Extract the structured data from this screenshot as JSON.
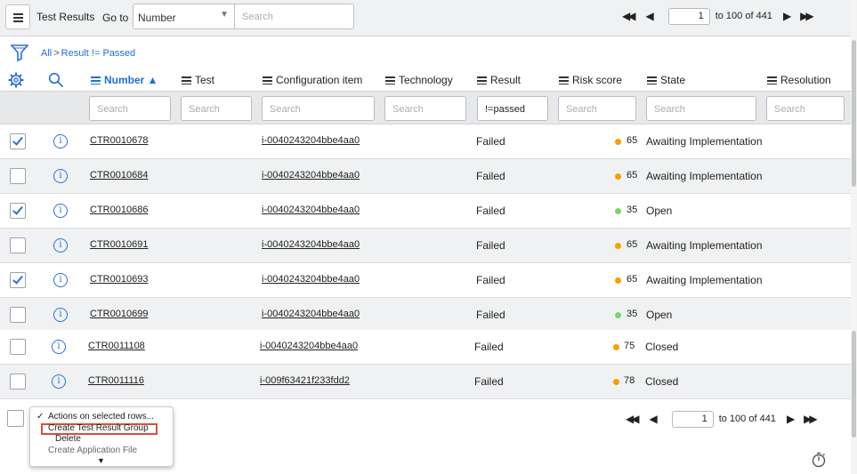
{
  "header": {
    "title": "Test Results",
    "goto_label": "Go to",
    "goto_select": "Number",
    "goto_search_placeholder": "Search",
    "pager": {
      "first": "◀◀",
      "prev": "◀",
      "next": "▶",
      "last": "▶▶",
      "page_value": "1",
      "range_text": "to 100 of 441"
    }
  },
  "breadcrumb": {
    "all": "All",
    "separator": ">",
    "filter": "Result != Passed"
  },
  "columns": {
    "number": "Number ▲",
    "test": "Test",
    "configuration_item": "Configuration item",
    "technology": "Technology",
    "result": "Result",
    "risk_score": "Risk score",
    "state": "State",
    "resolution": "Resolution"
  },
  "filters": {
    "number": "Search",
    "test": "Search",
    "configuration_item": "Search",
    "technology": "Search",
    "result": "!=passed",
    "risk_score": "Search",
    "state": "Search",
    "resolution": "Search"
  },
  "rows": [
    {
      "checked": true,
      "number": "CTR0010678",
      "ci": "i-0040243204bbe4aa0",
      "result": "Failed",
      "score": "65",
      "score_color": "#f4a100",
      "state": "Awaiting Implementation"
    },
    {
      "checked": false,
      "number": "CTR0010684",
      "ci": "i-0040243204bbe4aa0",
      "result": "Failed",
      "score": "65",
      "score_color": "#f4a100",
      "state": "Awaiting Implementation"
    },
    {
      "checked": true,
      "number": "CTR0010686",
      "ci": "i-0040243204bbe4aa0",
      "result": "Failed",
      "score": "35",
      "score_color": "#7ed46a",
      "state": "Open"
    },
    {
      "checked": false,
      "number": "CTR0010691",
      "ci": "i-0040243204bbe4aa0",
      "result": "Failed",
      "score": "65",
      "score_color": "#f4a100",
      "state": "Awaiting Implementation"
    },
    {
      "checked": true,
      "number": "CTR0010693",
      "ci": "i-0040243204bbe4aa0",
      "result": "Failed",
      "score": "65",
      "score_color": "#f4a100",
      "state": "Awaiting Implementation"
    },
    {
      "checked": false,
      "number": "CTR0010699",
      "ci": "i-0040243204bbe4aa0",
      "result": "Failed",
      "score": "35",
      "score_color": "#7ed46a",
      "state": "Open"
    },
    {
      "checked": false,
      "number": "CTR0011108",
      "ci": "i-0040243204bbe4aa0",
      "result": "Failed",
      "score": "75",
      "score_color": "#f4a100",
      "state": "Closed"
    },
    {
      "checked": false,
      "number": "CTR0011116",
      "ci": "i-009f63421f233fdd2",
      "result": "Failed",
      "score": "78",
      "score_color": "#f4a100",
      "state": "Closed"
    }
  ],
  "actions_menu": {
    "title": "Actions on selected rows...",
    "create_group": "Create Test Result Group",
    "delete": "Delete",
    "create_app_file": "Create Application File",
    "more": "▼"
  },
  "footer_pager": {
    "first": "◀◀",
    "prev": "◀",
    "next": "▶",
    "last": "▶▶",
    "page_value": "1",
    "range_text": "to 100 of 441"
  },
  "icons": {
    "menu": "hamburger-icon",
    "filter": "funnel-icon",
    "settings": "gear-icon",
    "search": "search-icon",
    "info": "info-icon",
    "timer": "stopwatch-icon"
  }
}
